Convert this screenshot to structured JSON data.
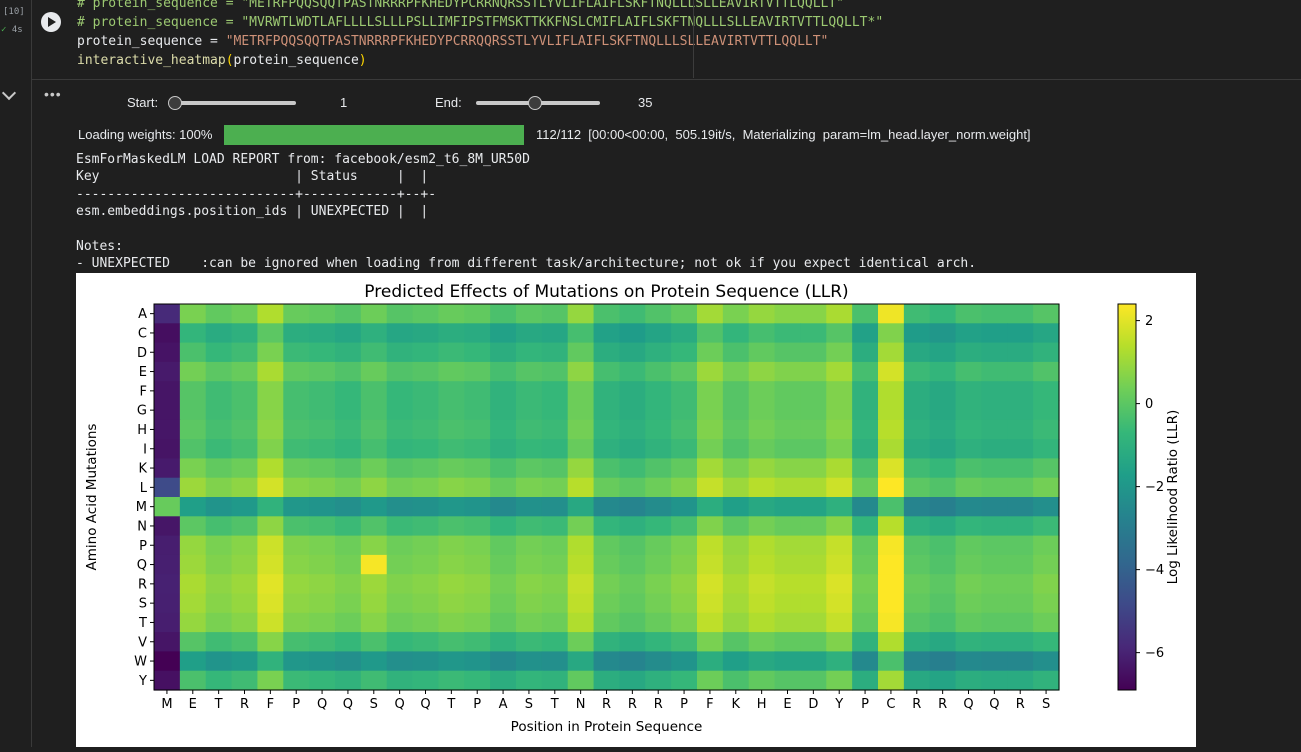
{
  "cell": {
    "exec_count": "[10]",
    "exec_time": "4s",
    "code_lines": [
      {
        "kind": "comment",
        "text": "# protein_sequence = \"METRFPQQSQQTPASTNRRRPFKHEDYPCRRNQRSSTLYVLIFLAIFLSKFTNQLLLSLLEAVIRTVTTLQQLLT\""
      },
      {
        "kind": "comment",
        "text": "# protein_sequence = \"MVRWTLWDTLAFLLLLSLLLPSLLIMFIPSTFMSKTTKKFNSLCMIFLAIFLSKFTNQLLLSLLEAVIRTVTTLQQLLT*\""
      },
      {
        "kind": "assign",
        "var": "protein_sequence = ",
        "value": "\"METRFPQQSQQTPASTNRRRPFKHEDYPCRRQQRSSTLYVLIFLAIFLSKFTNQLLLSLLEAVIRTVTTLQQLLT\""
      },
      {
        "kind": "call",
        "fn": "interactive_heatmap",
        "open": "(",
        "arg": "protein_sequence",
        "close": ")"
      }
    ]
  },
  "widgets": {
    "start": {
      "label": "Start:",
      "value": "1",
      "fraction": 0.0
    },
    "end": {
      "label": "End:",
      "value": "35",
      "fraction": 0.47
    }
  },
  "progress": {
    "label": "Loading weights: 100%",
    "fraction": 1.0,
    "info": "112/112  [00:00<00:00,  505.19it/s,  Materializing  param=lm_head.layer_norm.weight]"
  },
  "log_lines": [
    "EsmForMaskedLM LOAD REPORT from: facebook/esm2_t6_8M_UR50D",
    "Key                         | Status     |  |",
    "----------------------------+------------+--+-",
    "esm.embeddings.position_ids | UNEXPECTED |  |",
    "",
    "Notes:",
    "- UNEXPECTED    :can be ignored when loading from different task/architecture; not ok if you expect identical arch."
  ],
  "chart_data": {
    "type": "heatmap",
    "title": "Predicted Effects of Mutations on Protein Sequence (LLR)",
    "xlabel": "Position in Protein Sequence",
    "ylabel": "Amino Acid Mutations",
    "colorbar_label": "Log Likelihood Ratio (LLR)",
    "colormap": "viridis",
    "vmin": -6.9,
    "vmax": 2.4,
    "colorbar_ticks": [
      -6,
      -4,
      -2,
      0,
      2
    ],
    "x_labels": [
      "M",
      "E",
      "T",
      "R",
      "F",
      "P",
      "Q",
      "Q",
      "S",
      "Q",
      "Q",
      "T",
      "P",
      "A",
      "S",
      "T",
      "N",
      "R",
      "R",
      "R",
      "P",
      "F",
      "K",
      "H",
      "E",
      "D",
      "Y",
      "P",
      "C",
      "R",
      "R",
      "Q",
      "Q",
      "R",
      "S"
    ],
    "y_labels": [
      "A",
      "C",
      "D",
      "E",
      "F",
      "G",
      "H",
      "I",
      "K",
      "L",
      "M",
      "N",
      "P",
      "Q",
      "R",
      "S",
      "T",
      "V",
      "W",
      "Y"
    ],
    "column_base": [
      -6.3,
      0.2,
      -0.2,
      0.0,
      1.0,
      -0.1,
      -0.2,
      -0.4,
      0.0,
      -0.4,
      -0.3,
      -0.1,
      -0.2,
      -0.6,
      -0.3,
      -0.4,
      0.6,
      -0.6,
      -0.8,
      -0.5,
      -0.2,
      0.8,
      0.2,
      0.6,
      0.4,
      0.4,
      0.9,
      -0.6,
      1.6,
      -0.8,
      -1.0,
      -0.6,
      -0.7,
      -0.7,
      -0.4
    ],
    "row_offset": [
      0.3,
      -1.0,
      -0.5,
      0.2,
      -0.3,
      -0.3,
      -0.2,
      -0.4,
      0.3,
      0.8,
      -1.9,
      -0.2,
      0.7,
      0.8,
      1.0,
      0.9,
      0.7,
      -0.3,
      -1.9,
      -0.5
    ],
    "overrides": [
      {
        "row": "A",
        "col": 0,
        "value": -5.8
      },
      {
        "row": "M",
        "col": 0,
        "value": 0.2
      },
      {
        "row": "W",
        "col": 0,
        "value": -6.9
      },
      {
        "row": "Y",
        "col": 0,
        "value": -6.5
      },
      {
        "row": "L",
        "col": 0,
        "value": -4.8
      },
      {
        "row": "Q",
        "col": 8,
        "value": 2.3
      },
      {
        "row": "R",
        "col": 28,
        "value": 2.4
      },
      {
        "row": "A",
        "col": 28,
        "value": 2.2
      }
    ]
  }
}
